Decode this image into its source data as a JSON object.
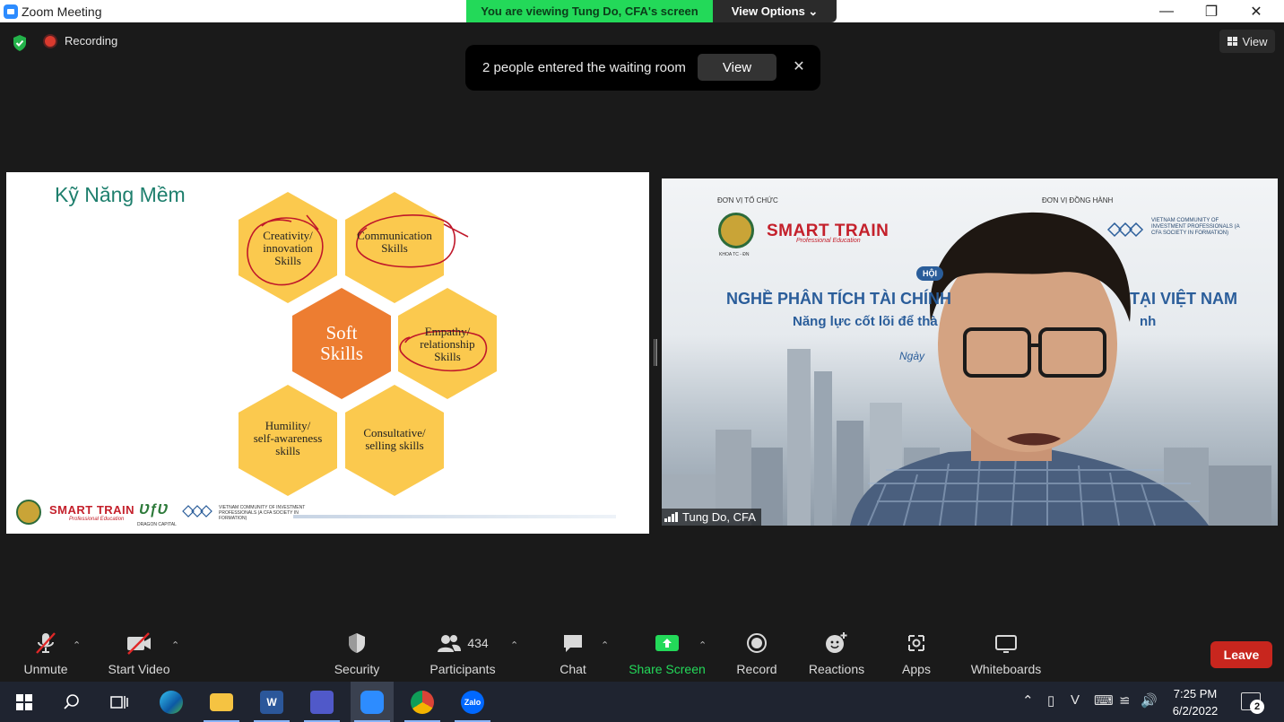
{
  "window": {
    "title": "Zoom Meeting",
    "viewing_banner": "You are viewing Tung Do, CFA's screen",
    "view_options": "View Options ⌄"
  },
  "top": {
    "recording": "Recording",
    "view_label": "View"
  },
  "waiting_room": {
    "message": "2 people entered the waiting room",
    "view_button": "View",
    "close_glyph": "✕"
  },
  "slide": {
    "title": "Kỹ Năng Mềm",
    "center": "Soft\nSkills",
    "hexes": [
      "Creativity/\ninnovation\nSkills",
      "Communication\nSkills",
      "Empathy/\nrelationship\nSkills",
      "Humility/\nself-awareness\nskills",
      "Consultative/\nselling skills"
    ],
    "footer": {
      "smart": "SMART TRAIN",
      "smart_sub": "Professional Education",
      "dragon": "ƲƒƲ",
      "dragon_sub": "DRAGON CAPITAL",
      "vcip": "VIETNAM COMMUNITY OF INVESTMENT PROFESSIONALS (A CFA SOCIETY IN FORMATION)"
    },
    "colors": {
      "hex": "#fbc94e",
      "center": "#ed7d31",
      "ink": "#c0182a",
      "title": "#1e7f6d"
    }
  },
  "webcam": {
    "org_left": "ĐƠN VỊ TỔ CHỨC",
    "org_right": "ĐƠN VỊ ĐỒNG HÀNH",
    "smart": "SMART TRAIN",
    "smart_sub": "Professional Education",
    "seal_sub": "KHOA TC - ĐN",
    "vcip": "VIETNAM COMMUNITY OF INVESTMENT PROFESSIONALS (A CFA SOCIETY IN FORMATION)",
    "badge": "HỘI",
    "headline_left": "NGHỀ PHÂN TÍCH TÀI CHÍNH",
    "headline_right": "TẠI VIỆT NAM",
    "sub_left": "Năng lực cốt lõi để thà",
    "sub_right": "nh",
    "date": "Ngày",
    "participant_name": "Tung Do, CFA"
  },
  "toolbar": {
    "unmute": "Unmute",
    "start_video": "Start Video",
    "security": "Security",
    "participants": "Participants",
    "participant_count": "434",
    "chat": "Chat",
    "share_screen": "Share Screen",
    "record": "Record",
    "reactions": "Reactions",
    "apps": "Apps",
    "whiteboards": "Whiteboards",
    "leave": "Leave",
    "share_color": "#23d959",
    "leave_color": "#c8261e"
  },
  "taskbar": {
    "word_letter": "W",
    "zalo_label": "Zalo",
    "time": "7:25 PM",
    "date": "6/2/2022",
    "notification_count": "2"
  }
}
